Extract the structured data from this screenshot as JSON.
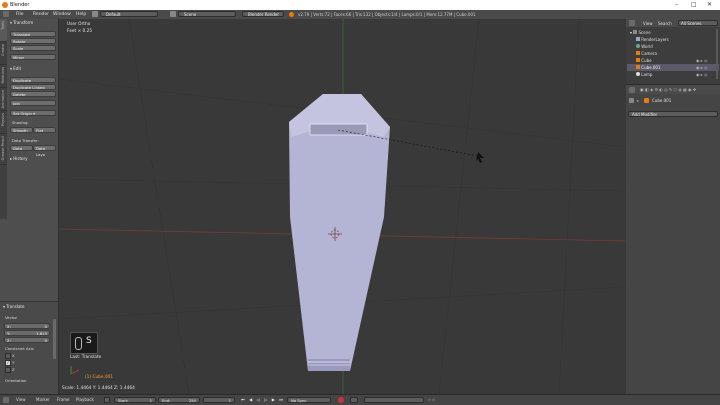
{
  "window": {
    "title": "Blender",
    "controls": [
      "–",
      "□",
      "✕"
    ]
  },
  "info_header": {
    "menus": [
      "File",
      "Render",
      "Window",
      "Help"
    ],
    "layout": "Default",
    "scene": "Scene",
    "engine": "Blender Render",
    "stats": "v2.79 | Verts:72 | Faces:66 | Tris:132 | Objects:1/4 | Lamps:0/1 | Mem:12.77M | Cube.001"
  },
  "tool_shelf": {
    "tabs": [
      "Tools",
      "Create",
      "Relations",
      "Animation",
      "Physics",
      "Grease Pencil"
    ],
    "transform_header": "Transform",
    "transform_buttons": [
      "Translate",
      "Rotate",
      "Scale",
      "Mirror"
    ],
    "edit_header": "Edit",
    "edit_buttons": [
      "Duplicate",
      "Duplicate Linked",
      "Delete",
      "Join"
    ],
    "set_origin": "Set Origin",
    "shading_label": "Shading:",
    "shading_buttons": [
      "Smooth",
      "Flat"
    ],
    "data_transfer_label": "Data Transfer:",
    "data_transfer_buttons": [
      "Data",
      "Data Layo"
    ],
    "history_header": "History"
  },
  "operator_panel": {
    "header": "Translate",
    "vector_label": "Vector",
    "fields": [
      {
        "axis": "X:",
        "value": "0"
      },
      {
        "axis": "Y:",
        "value": "1.615"
      },
      {
        "axis": "Z:",
        "value": "0"
      }
    ],
    "constraint_label": "Constraint Axis",
    "constraints": [
      {
        "axis": "X",
        "checked": false
      },
      {
        "axis": "Y",
        "checked": true
      },
      {
        "axis": "Z",
        "checked": false
      }
    ],
    "orientation_label": "Orientation"
  },
  "viewport": {
    "view_name": "User Ortho",
    "info_line": "Feet × 0.25",
    "status_line": "Scale: 1.4464  Y: 1.4464  Z: 1.4464",
    "object_label": "(1) Cube.001",
    "key_overlay": "S",
    "last_op": "Last: Translate"
  },
  "outliner": {
    "tabs": [
      "View",
      "Search",
      "All Scenes"
    ],
    "items": [
      {
        "name": "Scene",
        "icon": "scene-icon",
        "indent": 0
      },
      {
        "name": "RenderLayers",
        "icon": "render-layer-icon",
        "indent": 1
      },
      {
        "name": "World",
        "icon": "world-icon",
        "indent": 1
      },
      {
        "name": "Camera",
        "icon": "camera-icon",
        "indent": 1
      },
      {
        "name": "Cube",
        "icon": "mesh-icon",
        "indent": 1
      },
      {
        "name": "Cube.001",
        "icon": "mesh-icon",
        "indent": 1
      },
      {
        "name": "Lamp",
        "icon": "lamp-icon",
        "indent": 1
      }
    ]
  },
  "properties": {
    "breadcrumb": "Cube.001",
    "add_modifier": "Add Modifier"
  },
  "timeline": {
    "menus": [
      "View",
      "Marker",
      "Frame",
      "Playback"
    ],
    "start_label": "Start:",
    "start_value": "1",
    "end_label": "End:",
    "end_value": "250",
    "current_frame": "1",
    "sync": "No Sync"
  },
  "colors": {
    "accent": "#e87d0d",
    "mesh": "#b6b6d8",
    "selected_text": "#f0a030"
  }
}
